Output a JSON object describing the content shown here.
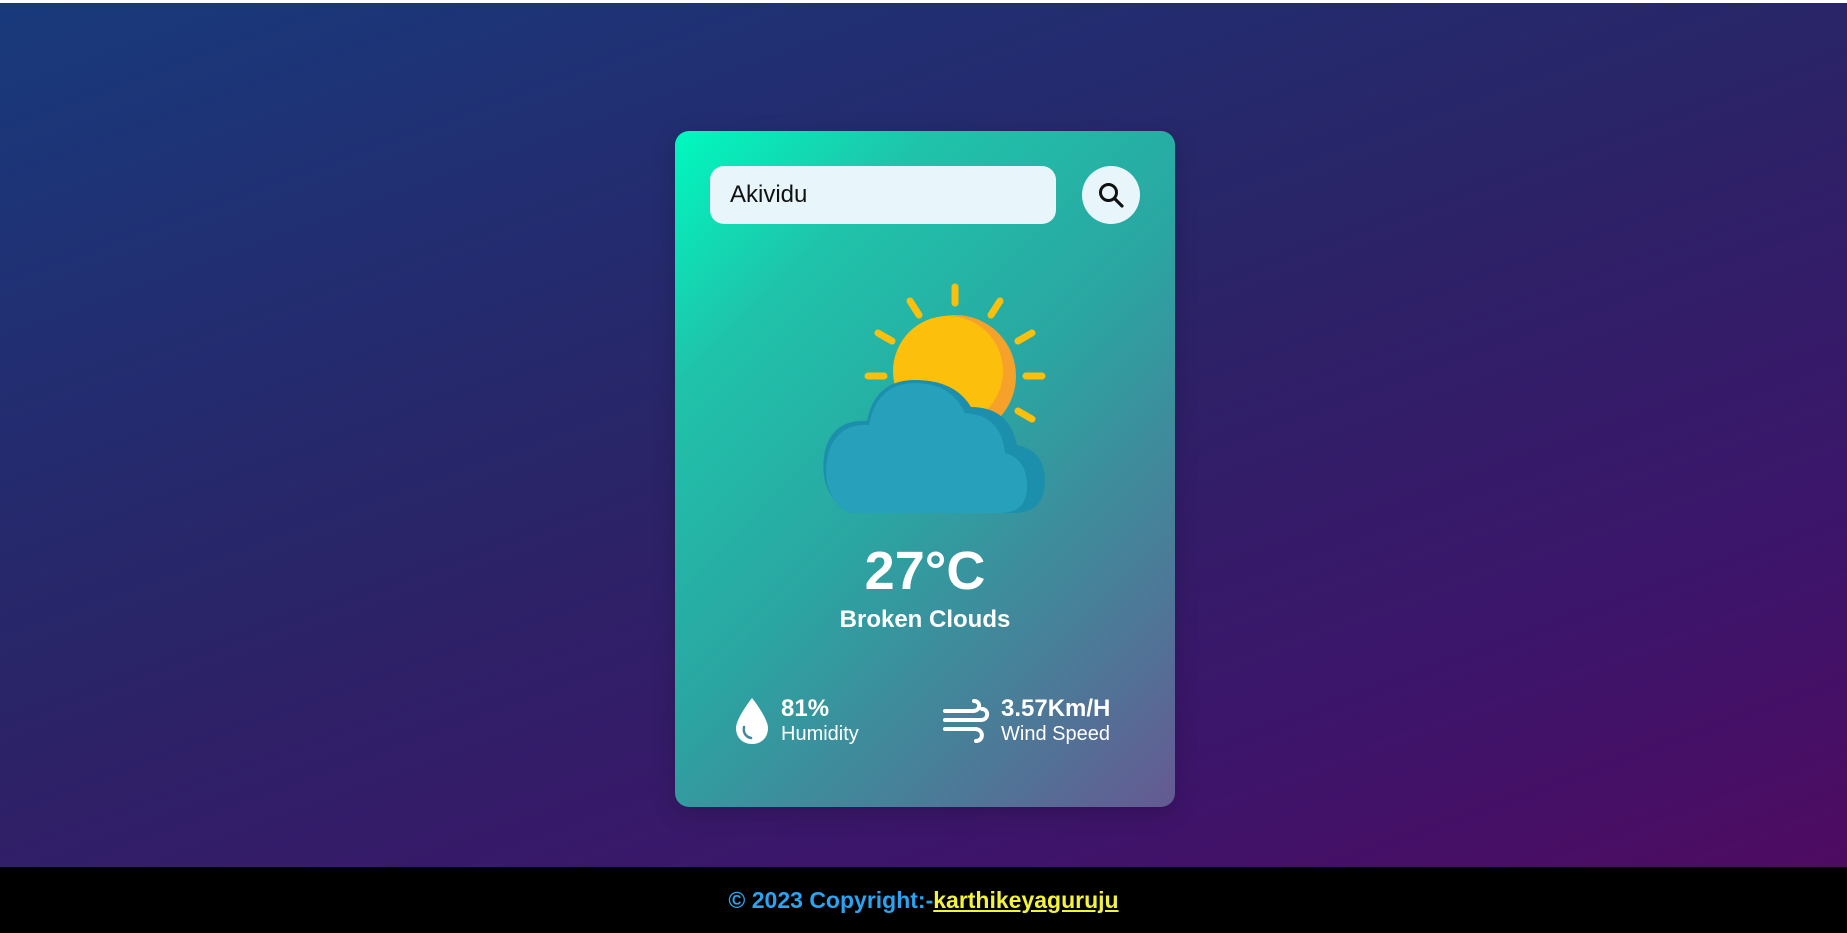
{
  "search": {
    "value": "Akividu",
    "placeholder": ""
  },
  "weather": {
    "icon": "sun-behind-cloud-icon",
    "temperature": "27°C",
    "description": "Broken Clouds"
  },
  "details": {
    "humidity": {
      "value": "81%",
      "label": "Humidity",
      "icon": "water-drop-icon"
    },
    "wind": {
      "value": "3.57Km/H",
      "label": "Wind Speed",
      "icon": "wind-icon"
    }
  },
  "footer": {
    "copyright": "© 2023 Copyright:-",
    "author": "karthikeyaguruju"
  },
  "colors": {
    "background_start": "#183a7c",
    "background_end": "#4f0b62",
    "card_start": "#00f9bf",
    "card_end": "#655992",
    "input_bg": "#e8f6fb",
    "footer_bg": "#000000",
    "footer_text": "#2aa3f0",
    "author_link": "#f3f33a",
    "sun": "#fbbf0c",
    "cloud": "#27a1bb"
  }
}
